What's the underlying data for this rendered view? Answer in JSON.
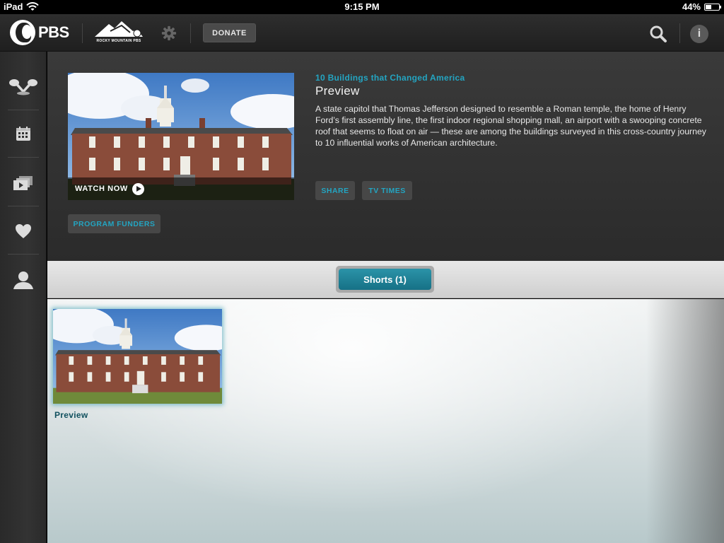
{
  "status_bar": {
    "device": "iPad",
    "time": "9:15 PM",
    "battery": "44%",
    "battery_level": 0.44
  },
  "top_nav": {
    "logo_text": "PBS",
    "station_label": "ROCKY MOUNTAIN PBS",
    "donate_label": "DONATE",
    "icons": [
      "settings-gear-icon",
      "search-icon",
      "info-icon"
    ],
    "info_glyph": "i"
  },
  "sidebar": {
    "items": [
      {
        "name": "featured",
        "icon": "spotlight-icon"
      },
      {
        "name": "schedule",
        "icon": "calendar-icon"
      },
      {
        "name": "videos",
        "icon": "video-stack-icon"
      },
      {
        "name": "favorites",
        "icon": "heart-icon"
      },
      {
        "name": "profile",
        "icon": "user-icon"
      }
    ]
  },
  "detail": {
    "show_title": "10 Buildings that Changed America",
    "episode_title": "Preview",
    "description": "A state capitol that Thomas Jefferson designed to resemble a Roman temple, the home of Henry Ford’s first assembly line, the first indoor regional shopping mall, an airport with a swooping concrete roof that seems to float on air — these are among the buildings surveyed in this cross-country journey to 10 influential works of American architecture.",
    "watch_now_label": "WATCH NOW",
    "share_label": "SHARE",
    "tv_times_label": "TV TIMES",
    "program_funders_label": "PROGRAM FUNDERS"
  },
  "shorts": {
    "tab_label": "Shorts (1)",
    "items": [
      {
        "label": "Preview"
      }
    ]
  },
  "colors": {
    "accent": "#23a5c2",
    "tab_active": "#1f8499",
    "nav_bg": "#262626"
  }
}
